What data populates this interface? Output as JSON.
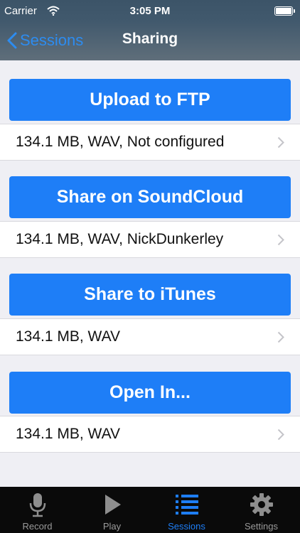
{
  "status_bar": {
    "carrier": "Carrier",
    "time": "3:05 PM"
  },
  "nav": {
    "back_label": "Sessions",
    "title": "Sharing"
  },
  "sections": [
    {
      "button": "Upload to FTP",
      "info": "134.1 MB, WAV, Not configured"
    },
    {
      "button": "Share on SoundCloud",
      "info": "134.1 MB, WAV, NickDunkerley"
    },
    {
      "button": "Share to iTunes",
      "info": "134.1 MB, WAV"
    },
    {
      "button": "Open In...",
      "info": "134.1 MB, WAV"
    }
  ],
  "tabs": [
    {
      "label": "Record",
      "icon": "microphone-icon"
    },
    {
      "label": "Play",
      "icon": "play-icon"
    },
    {
      "label": "Sessions",
      "icon": "list-icon",
      "active": true
    },
    {
      "label": "Settings",
      "icon": "gear-icon"
    }
  ],
  "colors": {
    "accent": "#1e7ef7",
    "tab_active": "#1e7ef7",
    "background": "#efeff4"
  }
}
